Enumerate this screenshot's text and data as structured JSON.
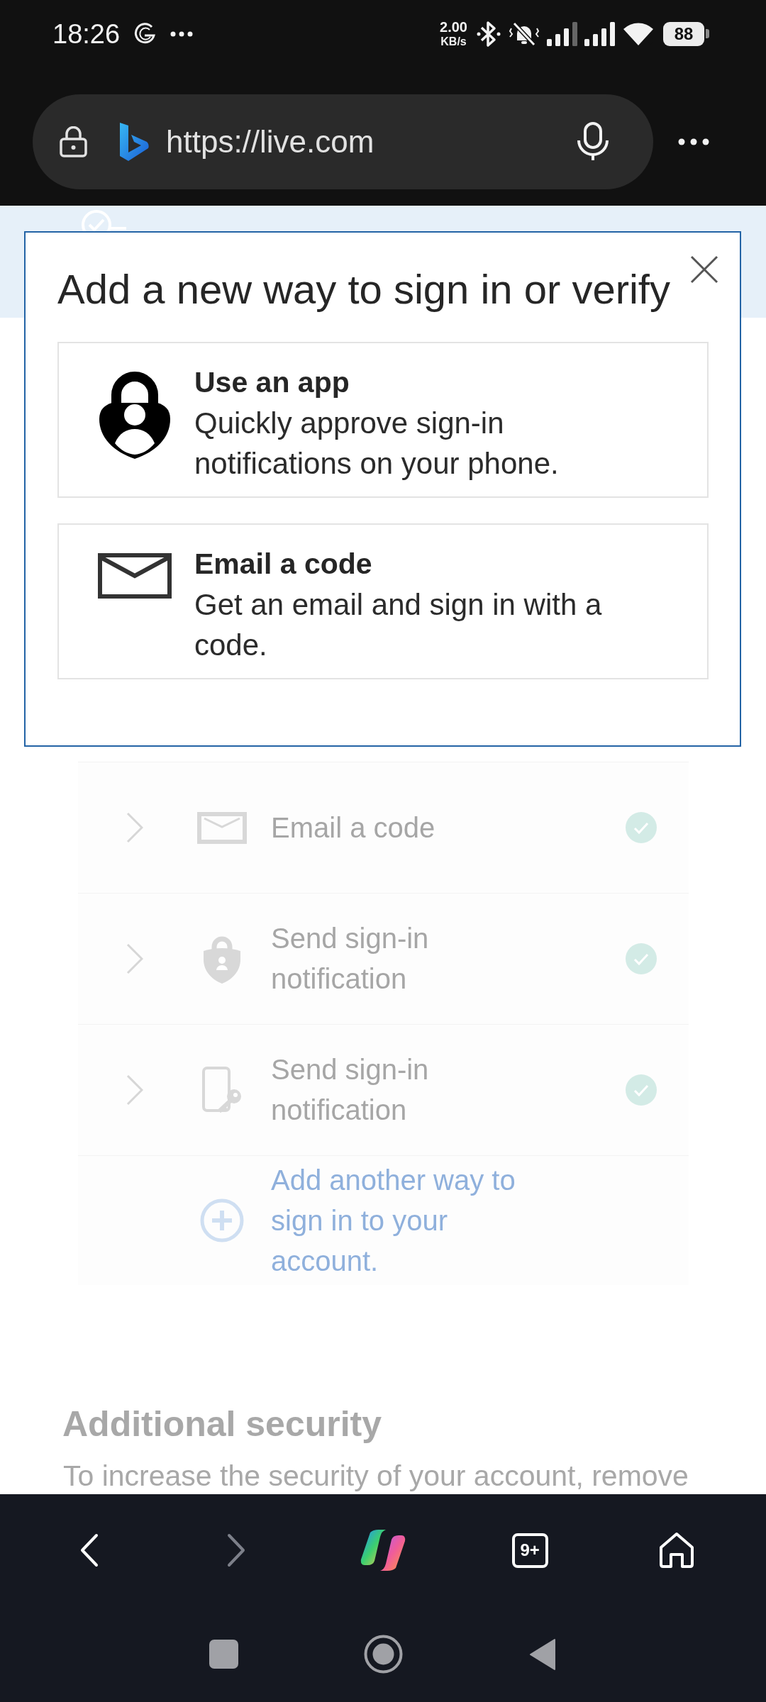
{
  "status_bar": {
    "time": "18:26",
    "speed_value": "2.00",
    "speed_unit": "KB/s",
    "battery": "88"
  },
  "address_bar": {
    "url": "https://live.com"
  },
  "methods": [
    {
      "label": "Email a code",
      "verified": true
    },
    {
      "label": "Send sign-in notification",
      "verified": true
    },
    {
      "label": "Send sign-in notification",
      "verified": true
    }
  ],
  "add_method": {
    "label": "Add another way to sign in to your account."
  },
  "additional_security": {
    "heading": "Additional security",
    "text": "To increase the security of your account, remove"
  },
  "dialog": {
    "title": "Add a new way to sign in or verify",
    "options": [
      {
        "title": "Use an app",
        "description": "Quickly approve sign-in notifications on your phone."
      },
      {
        "title": "Email a code",
        "description": "Get an email and sign in with a code."
      }
    ]
  },
  "toolbar": {
    "forward": {
      "disabled": true
    },
    "tab_count": "9+"
  }
}
